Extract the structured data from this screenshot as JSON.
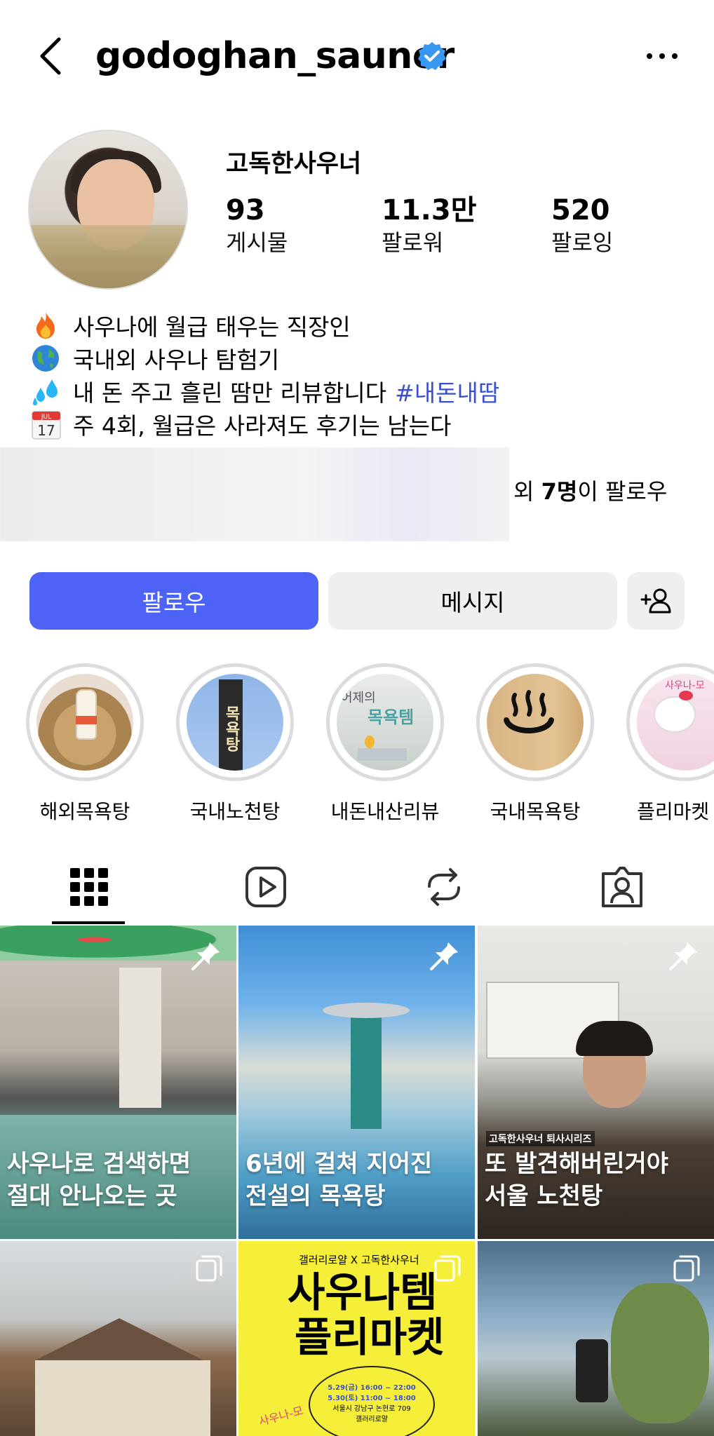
{
  "header": {
    "username": "godoghan_sauner",
    "verified": true,
    "more_icon": "more-horizontal-icon",
    "back_icon": "chevron-left-icon"
  },
  "profile": {
    "display_name": "고독한사우너",
    "stats": [
      {
        "value": "93",
        "label": "게시물"
      },
      {
        "value": "11.3만",
        "label": "팔로워"
      },
      {
        "value": "520",
        "label": "팔로잉"
      }
    ],
    "bio": [
      {
        "emoji": "fire-emoji",
        "text": "사우나에 월급 태우는 직장인"
      },
      {
        "emoji": "globe-emoji",
        "text": "국내외 사우나 탐험기"
      },
      {
        "emoji": "sweat-drops-emoji",
        "text": "내 돈 주고 흘린 땀만 리뷰합니다",
        "hashtag": "#내돈내땀"
      },
      {
        "emoji": "calendar-emoji",
        "calendar_month": "JUL",
        "calendar_day": "17",
        "text": "주 4회, 월급은 사라져도 후기는 남는다"
      }
    ],
    "followed_by": {
      "prefix": "외 ",
      "count": "7명",
      "suffix": "이 팔로우"
    }
  },
  "actions": {
    "follow_label": "팔로우",
    "message_label": "메시지",
    "add_user_icon": "add-person-icon",
    "accent": "#4d63f5"
  },
  "highlights": [
    {
      "label": "해외목욕탕"
    },
    {
      "label": "국내노천탕",
      "img_text": "목욕탕"
    },
    {
      "label": "내돈내산리뷰",
      "img_text_top": "어제의",
      "img_text": "목욕템"
    },
    {
      "label": "국내목욕탕"
    },
    {
      "label": "플리마켓 모",
      "img_text": "사우나-모"
    }
  ],
  "tabs": [
    {
      "name": "grid-icon",
      "active": true
    },
    {
      "name": "reels-icon",
      "active": false
    },
    {
      "name": "reposts-icon",
      "active": false
    },
    {
      "name": "tagged-icon",
      "active": false
    }
  ],
  "posts": [
    {
      "caption_1": "사우나로 검색하면",
      "caption_2": "절대 안나오는 곳",
      "pinned": true
    },
    {
      "caption_1": "6년에 걸쳐 지어진",
      "caption_2": "전설의 목욕탕",
      "pinned": true
    },
    {
      "series": "고독한사우너 퇴사시리즈",
      "caption_1": "또 발견해버린거야",
      "caption_2": "서울 노천탕",
      "pinned": true
    },
    {
      "pinned": false,
      "multi": true
    },
    {
      "pinned": false,
      "multi": true,
      "poster_top": "갤러리로얄 X 고독한사우너",
      "poster_title_1": "사우나템",
      "poster_title_2": "플리마켓",
      "poster_date_1": "5.29(금) 16:00 ~ 22:00",
      "poster_date_2": "5.30(토) 11:00 ~ 18:00",
      "poster_addr": "서울시 강남구 논현로 709",
      "poster_venue": "갤러리로얄",
      "poster_stamp": "사우나-모"
    },
    {
      "pinned": false,
      "multi": true
    }
  ]
}
